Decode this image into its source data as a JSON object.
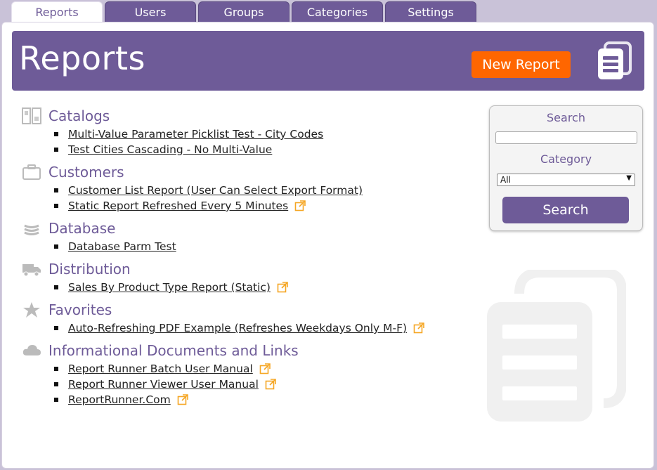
{
  "tabs": [
    {
      "label": "Reports",
      "active": true
    },
    {
      "label": "Users"
    },
    {
      "label": "Groups"
    },
    {
      "label": "Categories"
    },
    {
      "label": "Settings"
    }
  ],
  "header": {
    "title": "Reports",
    "new_report_label": "New Report",
    "icon": "documents-icon"
  },
  "categories": [
    {
      "name": "Catalogs",
      "icon": "catalog-icon",
      "items": [
        {
          "label": "Multi-Value Parameter Picklist Test - City Codes",
          "external": false
        },
        {
          "label": "Test Cities Cascading - No Multi-Value",
          "external": false
        }
      ]
    },
    {
      "name": "Customers",
      "icon": "briefcase-icon",
      "items": [
        {
          "label": "Customer List Report (User Can Select Export Format)",
          "external": false
        },
        {
          "label": "Static Report Refreshed Every 5 Minutes",
          "external": true
        }
      ]
    },
    {
      "name": "Database",
      "icon": "database-icon",
      "items": [
        {
          "label": "Database Parm Test",
          "external": false
        }
      ]
    },
    {
      "name": "Distribution",
      "icon": "truck-icon",
      "items": [
        {
          "label": "Sales By Product Type Report (Static)",
          "external": true
        }
      ]
    },
    {
      "name": "Favorites",
      "icon": "star-icon",
      "items": [
        {
          "label": "Auto-Refreshing PDF Example (Refreshes Weekdays Only M-F)",
          "external": true
        }
      ]
    },
    {
      "name": "Informational Documents and Links",
      "icon": "cloud-icon",
      "items": [
        {
          "label": "Report Runner Batch User Manual",
          "external": true
        },
        {
          "label": "Report Runner Viewer User Manual",
          "external": true
        },
        {
          "label": "ReportRunner.Com",
          "external": true
        }
      ]
    }
  ],
  "search": {
    "search_label": "Search",
    "input_value": "",
    "category_label": "Category",
    "category_selected": "All",
    "button_label": "Search"
  },
  "colors": {
    "brand": "#6e5b98",
    "accent": "#ff6600",
    "external_link": "#f5a623"
  }
}
